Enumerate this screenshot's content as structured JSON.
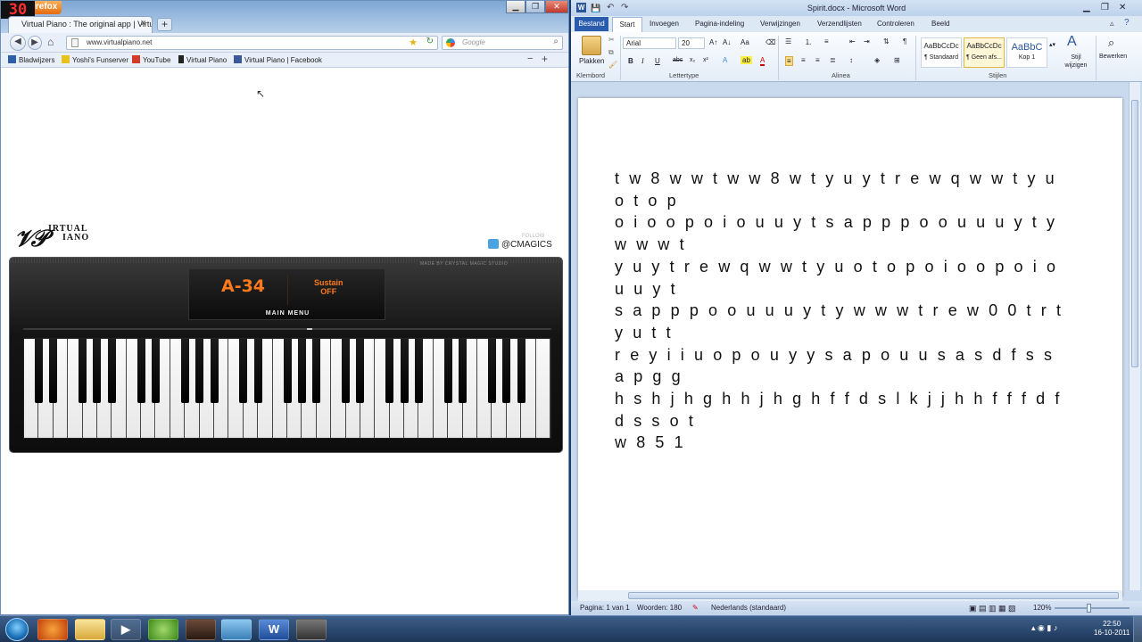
{
  "overlay": {
    "fps": "30"
  },
  "firefox": {
    "menu_label": "Firefox",
    "tab_title": "Virtual Piano : The original app | Virtual ...",
    "new_tab": "+",
    "url": "www.virtualpiano.net",
    "search_placeholder": "Google",
    "bookmarks": [
      {
        "label": "Bladwijzers",
        "icon": "bookmarks-icon"
      },
      {
        "label": "Yoshi's Funserver",
        "icon": "yfs-icon"
      },
      {
        "label": "YouTube",
        "icon": "youtube-icon"
      },
      {
        "label": "Virtual Piano",
        "icon": "vp-icon"
      },
      {
        "label": "Virtual Piano | Facebook",
        "icon": "facebook-icon"
      }
    ]
  },
  "piano_app": {
    "logo_line1": "IRTUAL",
    "logo_line2": "IANO",
    "twitter": "@CMAGICS",
    "follow": "FOLLOW",
    "current_note": "A-34",
    "sustain": "Sustain",
    "sustain_state": "OFF",
    "main_menu": "MAIN MENU",
    "maker": "MADE BY CRYSTAL MAGIC STUDIO"
  },
  "word": {
    "title": "Spirit.docx - Microsoft Word",
    "tabs": [
      "Bestand",
      "Start",
      "Invoegen",
      "Pagina-indeling",
      "Verwijzingen",
      "Verzendlijsten",
      "Controleren",
      "Beeld"
    ],
    "groups": [
      "Klembord",
      "Lettertype",
      "Alinea",
      "Stijlen"
    ],
    "paste": "Plakken",
    "font": "Arial",
    "size": "20",
    "styles": [
      {
        "preview": "AaBbCcDc",
        "name": "¶ Standaard"
      },
      {
        "preview": "AaBbCcDc",
        "name": "¶ Geen afs..."
      },
      {
        "preview": "AaBbC",
        "name": "Kop 1"
      }
    ],
    "change_styles": "Stijl wijzigen",
    "edit": "Bewerken",
    "document_lines": [
      "t w 8 w w t w w 8 w t y u y t r e w q w w t y u o t o p",
      "o i o o p o i o u u y t s a p p p o o u u u y t y w w w t",
      "y u y t r e w q w w t y u o t o p o i o o p o i o u u y t",
      "s a p p p o o u u u y t y w w w t r e w 0 0 t r t y u t t",
      "r e y i i u o p o u y y s a p o u u s a s d f s s a p g g",
      "h s h j h g h h j h g h f f d s l k j j h h f f f d f d s s o t",
      "w 8 5 1"
    ],
    "status": {
      "page": "Pagina: 1 van 1",
      "words": "Woorden: 180",
      "language": "Nederlands (standaard)",
      "zoom": "120%"
    }
  },
  "taskbar": {
    "time": "22:50",
    "date": "16-10-2011",
    "apps": [
      "start-orb",
      "firefox-icon",
      "explorer-icon",
      "media-player-icon",
      "chrome-icon",
      "game-icon",
      "network-icon",
      "word-icon",
      "app-icon"
    ]
  }
}
